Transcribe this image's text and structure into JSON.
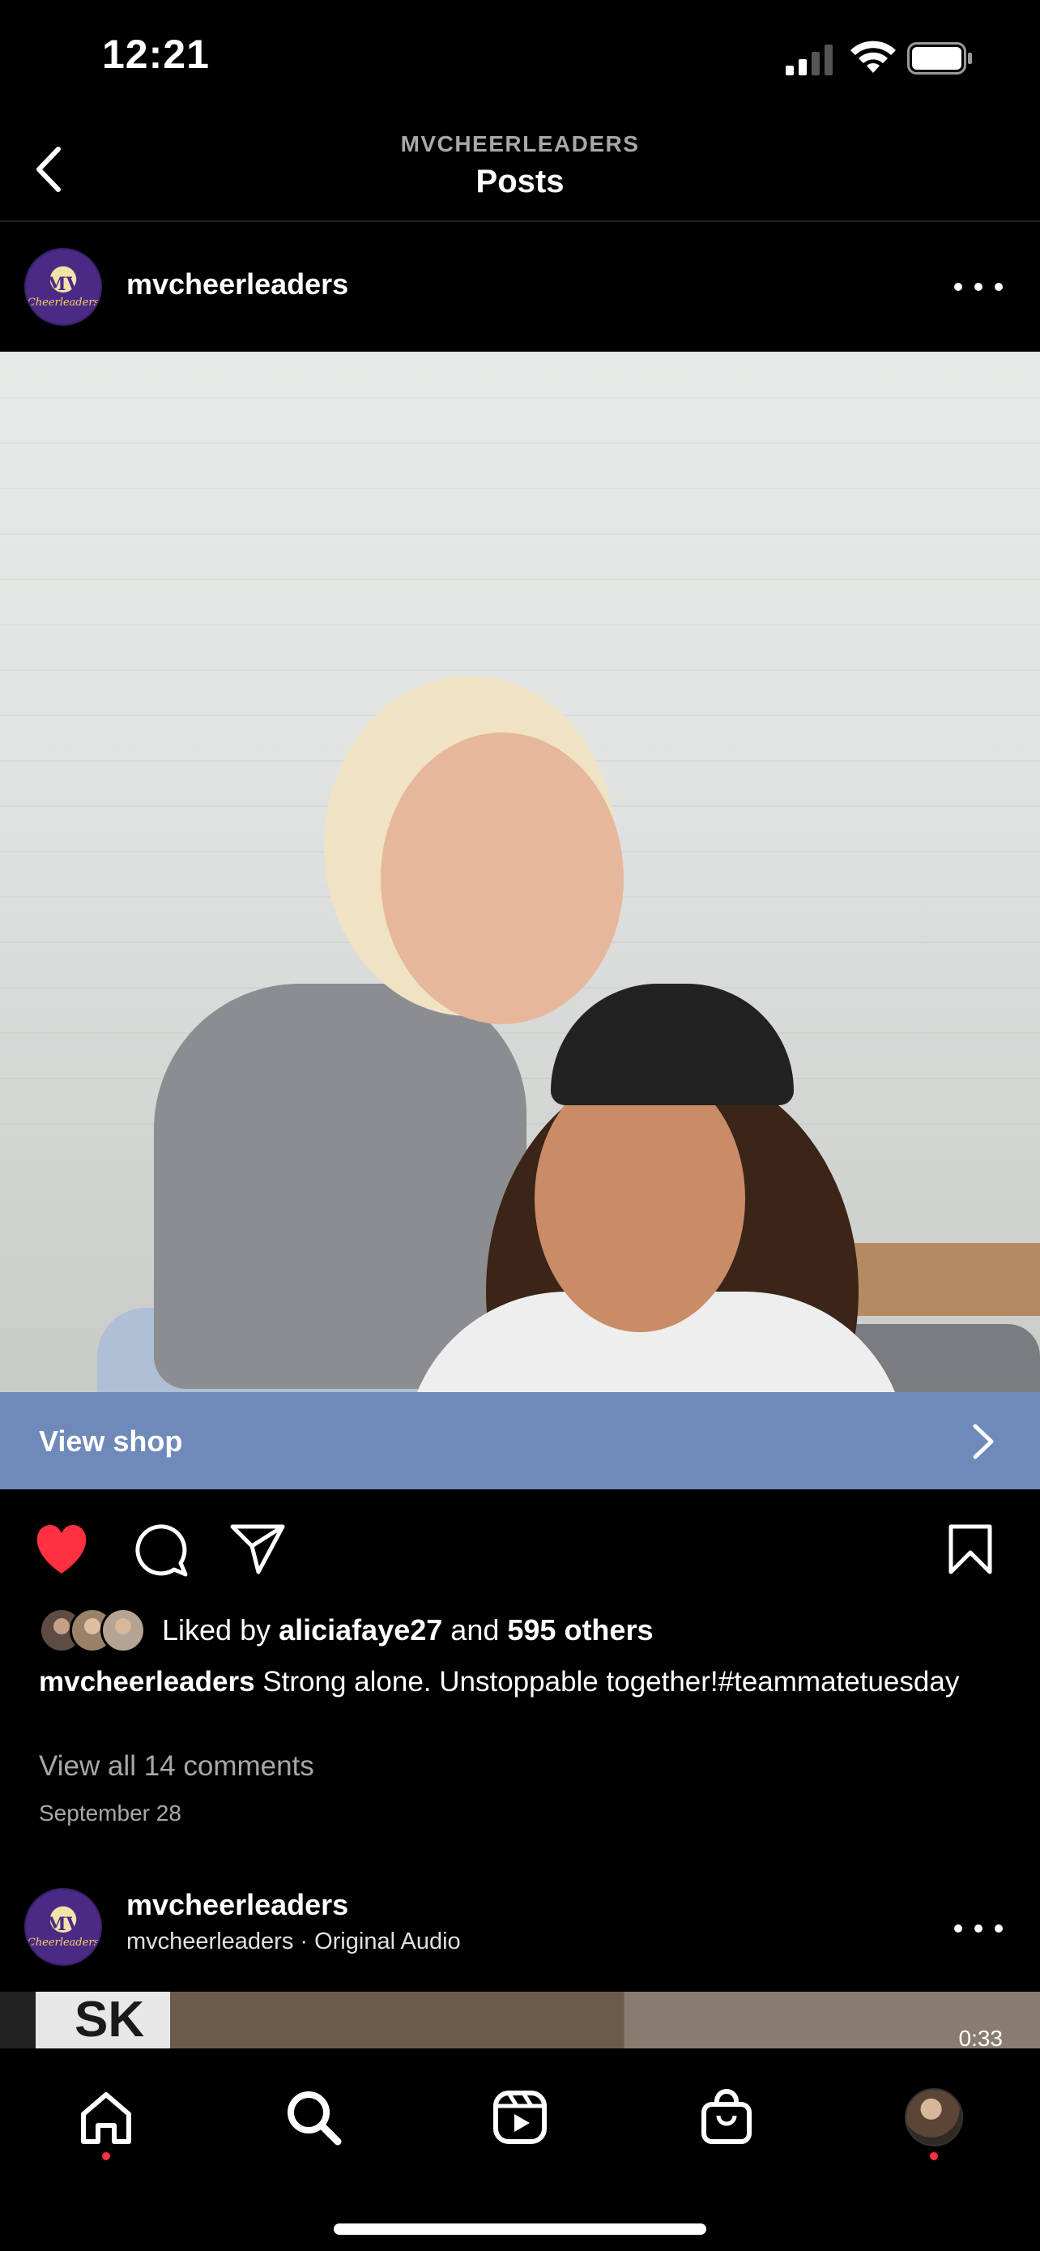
{
  "status_bar": {
    "time": "12:21"
  },
  "header": {
    "subtitle": "MVCHEERLEADERS",
    "title": "Posts"
  },
  "post": {
    "username": "mvcheerleaders",
    "avatar_text": "MV",
    "avatar_subtext": "Cheerleaders",
    "view_shop_label": "View shop",
    "likes": {
      "prefix": "Liked by",
      "user": "aliciafaye27",
      "joiner": "and",
      "others": "595 others"
    },
    "caption": {
      "username": "mvcheerleaders",
      "text": "Strong alone. Unstoppable together!#teammatetuesday"
    },
    "comments_link": "View all 14 comments",
    "date": "September 28",
    "liked": true
  },
  "post2": {
    "username": "mvcheerleaders",
    "audio": "mvcheerleaders · Original Audio",
    "preview_text": "SK",
    "duration": "0:33"
  },
  "icons": {
    "back": "chevron-left-icon",
    "more": "more-horizontal-icon",
    "shop_tag": "shopping-bag-icon",
    "like": "heart-icon",
    "comment": "comment-icon",
    "share": "paper-plane-icon",
    "save": "bookmark-icon",
    "tabs": [
      "home-icon",
      "search-icon",
      "reels-icon",
      "shop-icon",
      "profile-avatar"
    ]
  },
  "colors": {
    "like_red": "#ff3040",
    "view_shop_bg": "#6e89ba",
    "secondary_text": "#a8a8a8"
  }
}
